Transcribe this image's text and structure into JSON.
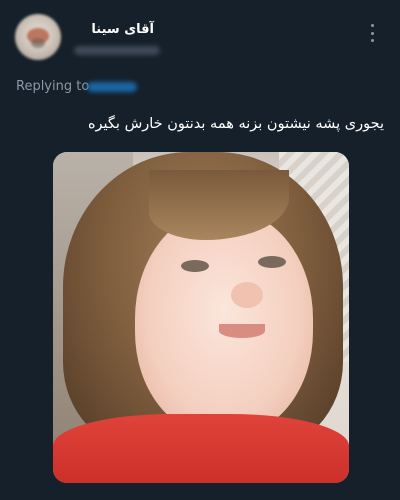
{
  "author": {
    "display_name": "آقای سینا",
    "avatar_icon": "avatar-image"
  },
  "reply": {
    "prefix": "Replying to"
  },
  "tweet": {
    "text": "یجوری پشه نیشتون بزنه همه بدنتون خارش بگیره"
  },
  "media": {
    "type": "photo",
    "description_icon": "photo"
  },
  "menu": {
    "icon": "more-vertical-icon"
  },
  "colors": {
    "background": "#15202b",
    "primary_text": "#ffffff",
    "secondary_text": "#8b98a5",
    "link": "#1d9bf0"
  }
}
